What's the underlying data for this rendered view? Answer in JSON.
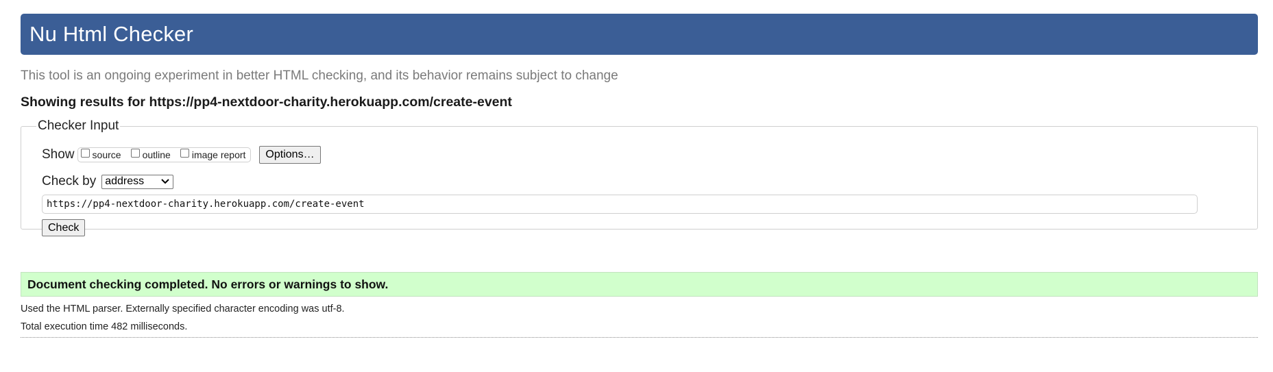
{
  "header": {
    "title": "Nu Html Checker"
  },
  "tagline": "This tool is an ongoing experiment in better HTML checking, and its behavior remains subject to change",
  "results": {
    "prefix": "Showing results for ",
    "url": "https://pp4-nextdoor-charity.herokuapp.com/create-event"
  },
  "checker_input": {
    "legend": "Checker Input",
    "show_label": "Show",
    "options": [
      {
        "label": "source",
        "checked": false
      },
      {
        "label": "outline",
        "checked": false
      },
      {
        "label": "image report",
        "checked": false
      }
    ],
    "options_button": "Options…",
    "check_by_label": "Check by",
    "check_by_value": "address",
    "url_value": "https://pp4-nextdoor-charity.herokuapp.com/create-event",
    "check_button": "Check"
  },
  "status": {
    "message": "Document checking completed. No errors or warnings to show.",
    "color": "#d1ffcc"
  },
  "info": {
    "parser": "Used the HTML parser. Externally specified character encoding was utf-8.",
    "time": "Total execution time 482 milliseconds."
  },
  "colors": {
    "banner": "#3b5e96"
  }
}
